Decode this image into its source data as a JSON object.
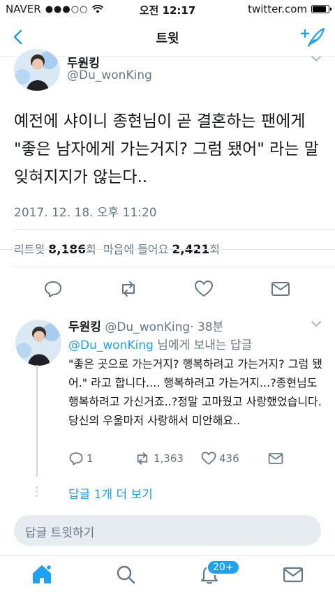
{
  "status_bar": {
    "carrier": "NAVER",
    "signal_dots": "●●●○○",
    "time": "오전 12:17",
    "url": "twitter.com",
    "battery_level": 0.9
  },
  "nav": {
    "title": "트윗"
  },
  "tweet": {
    "display_name": "두원킹",
    "handle": "@Du_wonKing",
    "text": "예전에 샤이니 종현님이 곧 결혼하는 팬에게 \"좋은 남자에게 가는거지? 그럼 됐어\" 라는 말 잊혀지지가 않는다..",
    "timestamp": "2017. 12. 18. 오후 11:20",
    "retweets_label": "리트윗",
    "retweets_count": "8,186",
    "count_unit": "회",
    "likes_label": "마음에 들어요",
    "likes_count": "2,421"
  },
  "reply": {
    "display_name": "두원킹",
    "handle": "@Du_wonKing",
    "time": "· 38분",
    "replying_mention": "@Du_wonKing",
    "replying_suffix": " 님에게 보내는 답글",
    "text": "\"좋은 곳으로 가는거지? 행복하려고 가는거지? 그럼 됐어.\" 라고 합니다.... 행복하려고 가는거지...?종현님도 행복하려고 가신거죠..?정말 고마웠고 사랑했었습니다. 당신의 우울마저 사랑해서 미안해요..",
    "reply_count": "1",
    "retweet_count": "1,363",
    "like_count": "436",
    "more_replies": "답글 1개 더 보기"
  },
  "reply_input": {
    "placeholder": "답글 트윗하기"
  },
  "tab_bar": {
    "notifications_badge": "20+"
  },
  "colors": {
    "accent": "#1da1f2",
    "muted": "#657786",
    "text": "#14171a",
    "border": "#e1e8ed"
  }
}
